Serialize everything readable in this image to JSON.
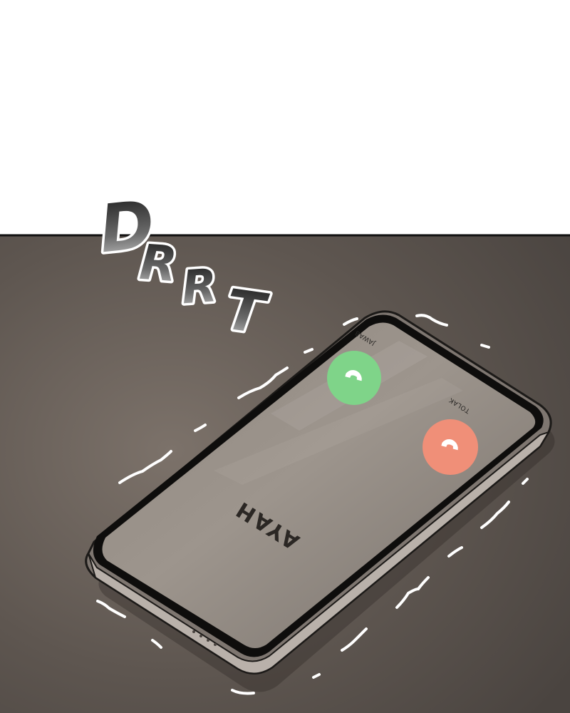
{
  "sound_effect": "DRRT",
  "phone": {
    "caller_name": "AYAH",
    "answer_label": "JAWAB",
    "decline_label": "TOLAK"
  },
  "colors": {
    "table": "#5e554f",
    "answer_button": "#7fd489",
    "decline_button": "#f08f78"
  },
  "icons": {
    "answer": "phone-answer-icon",
    "decline": "phone-decline-icon"
  }
}
